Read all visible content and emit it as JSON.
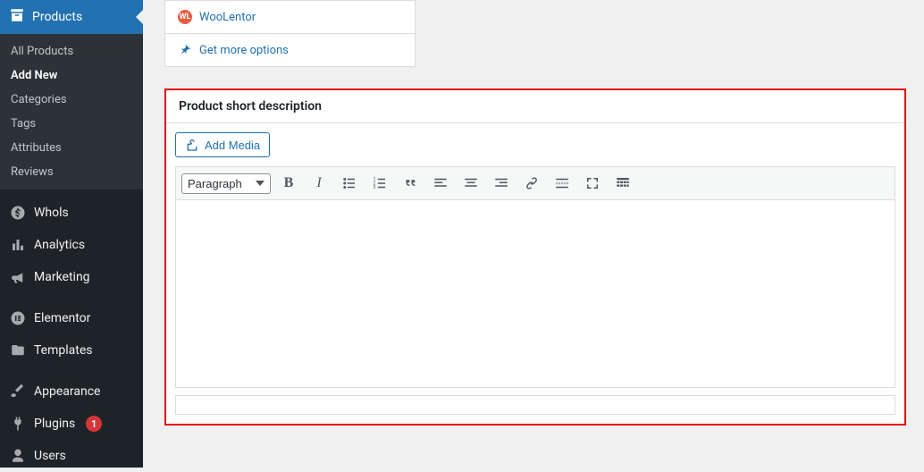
{
  "sidebar": {
    "header": {
      "label": "Products"
    },
    "submenu": [
      {
        "label": "All Products",
        "current": false
      },
      {
        "label": "Add New",
        "current": true
      },
      {
        "label": "Categories",
        "current": false
      },
      {
        "label": "Tags",
        "current": false
      },
      {
        "label": "Attributes",
        "current": false
      },
      {
        "label": "Reviews",
        "current": false
      }
    ],
    "menu": {
      "whols": "Whols",
      "analytics": "Analytics",
      "marketing": "Marketing",
      "elementor": "Elementor",
      "templates": "Templates",
      "appearance": "Appearance",
      "plugins": "Plugins",
      "plugins_badge": "1",
      "users": "Users"
    }
  },
  "panel": {
    "woolentor_badge": "WL",
    "woolentor": "WooLentor",
    "get_more": "Get more options"
  },
  "metabox": {
    "title": "Product short description",
    "add_media": "Add Media",
    "format_selected": "Paragraph"
  }
}
